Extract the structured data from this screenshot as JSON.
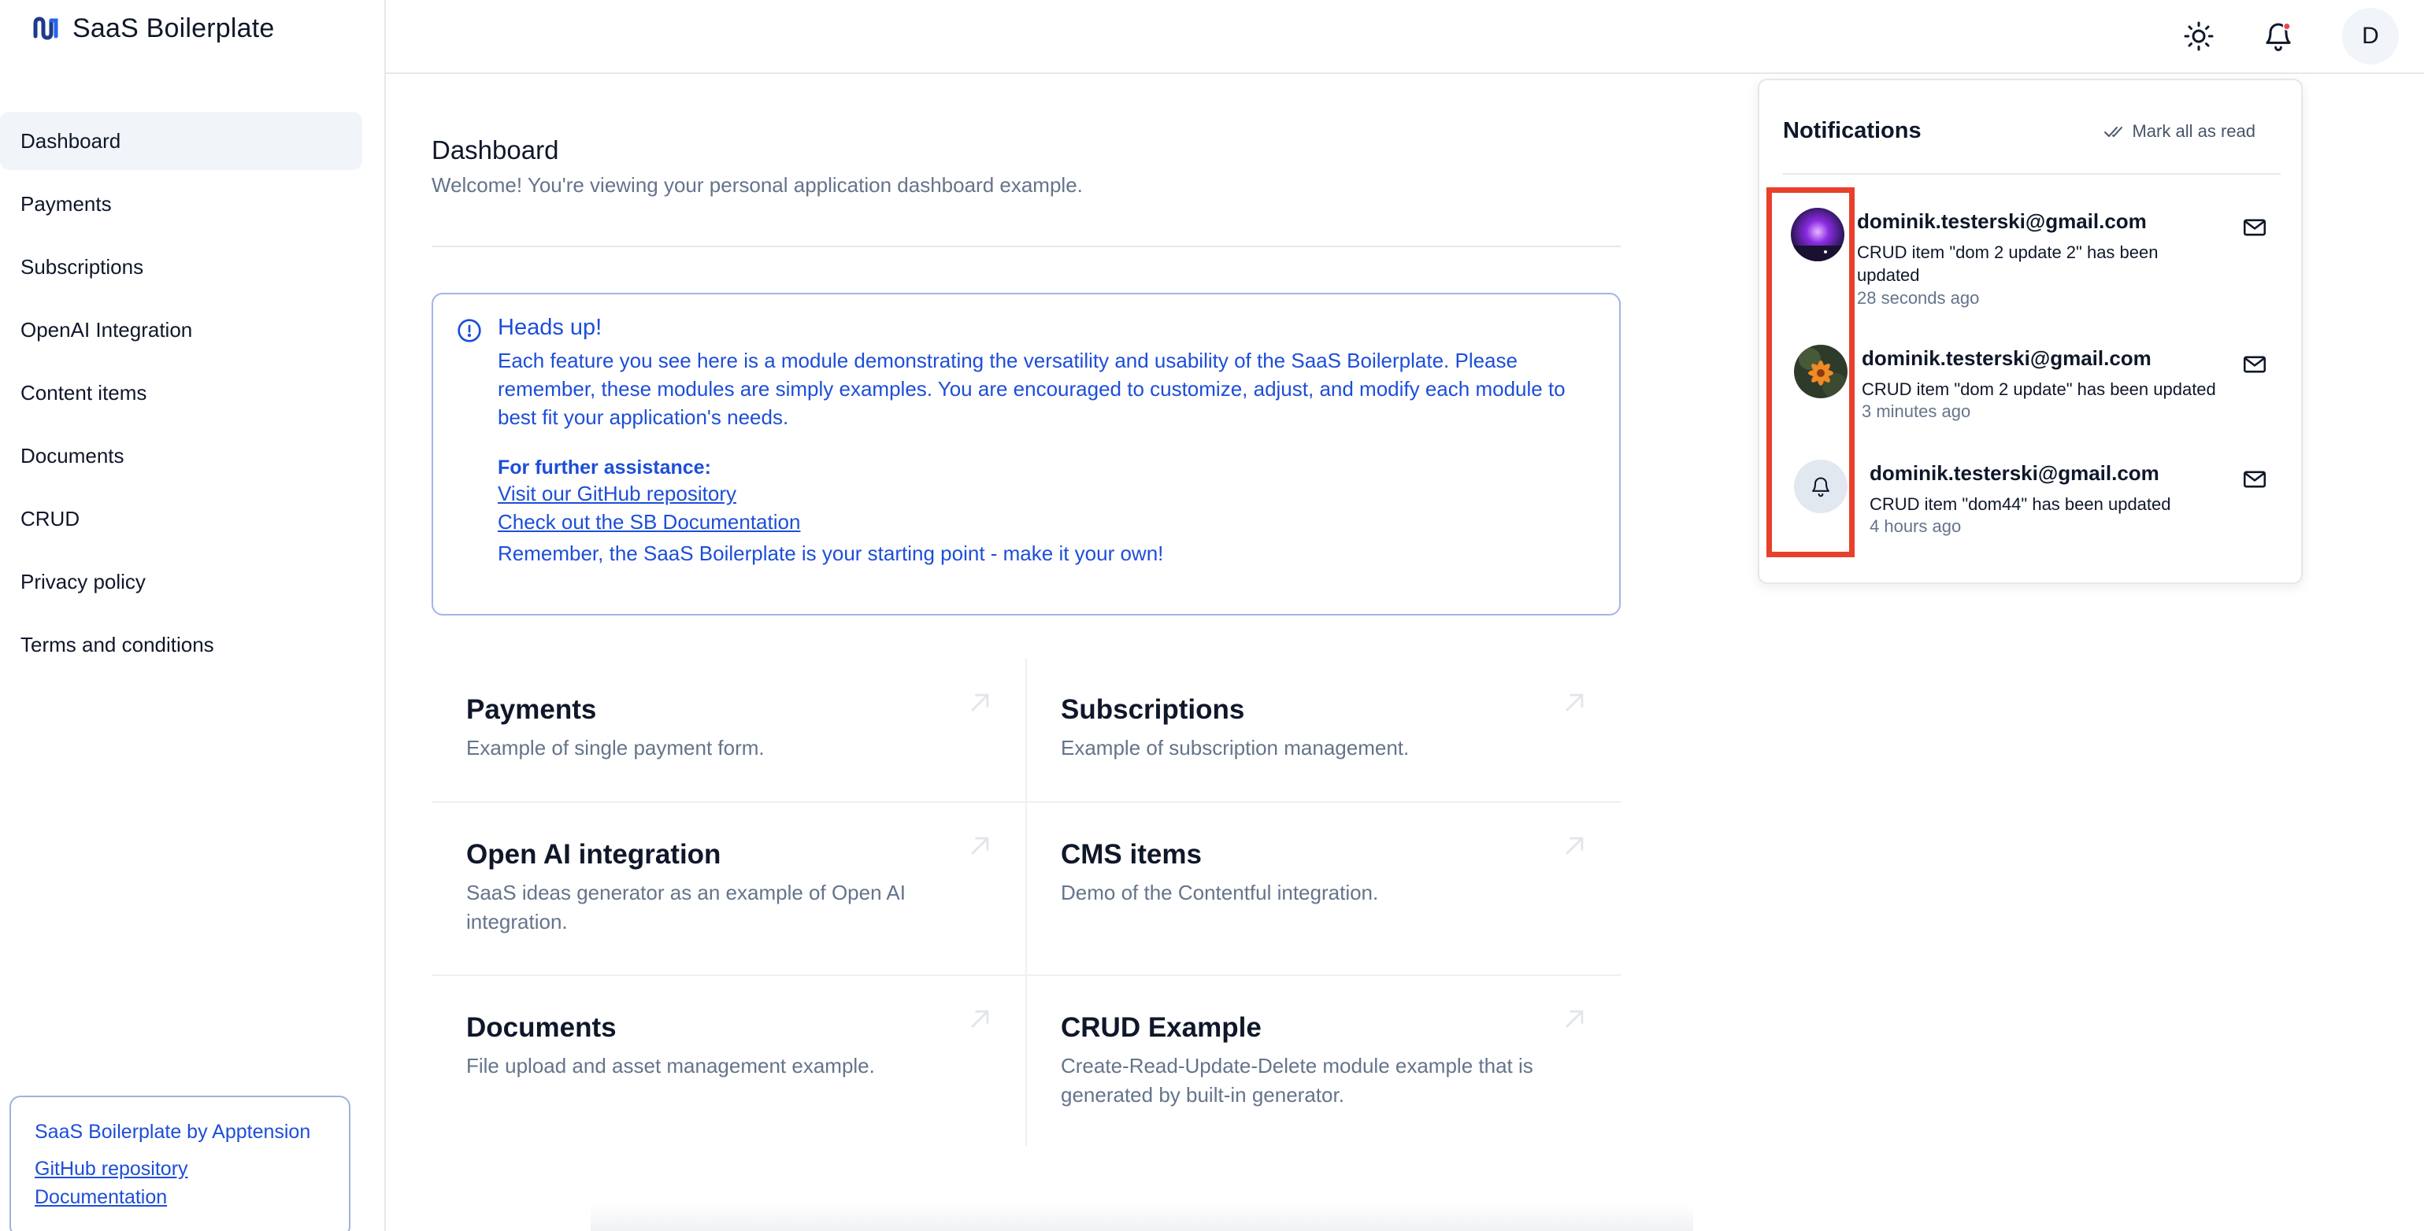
{
  "app": {
    "name": "SaaS Boilerplate"
  },
  "sidebar": {
    "items": [
      {
        "label": "Dashboard"
      },
      {
        "label": "Payments"
      },
      {
        "label": "Subscriptions"
      },
      {
        "label": "OpenAI Integration"
      },
      {
        "label": "Content items"
      },
      {
        "label": "Documents"
      },
      {
        "label": "CRUD"
      },
      {
        "label": "Privacy policy"
      },
      {
        "label": "Terms and conditions"
      }
    ],
    "active_item": "Dashboard",
    "footer": {
      "title": "SaaS Boilerplate by Apptension",
      "github_link": "GitHub repository",
      "docs_link": "Documentation"
    }
  },
  "header": {
    "avatar_initial": "D",
    "icons": [
      "sun-icon",
      "bell-icon"
    ],
    "unread_dot_color": "#ef4444"
  },
  "main": {
    "title": "Dashboard",
    "subtitle": "Welcome! You're viewing your personal application dashboard example.",
    "alert": {
      "title": "Heads up!",
      "body": "Each feature you see here is a module demonstrating the versatility and usability of the SaaS Boilerplate. Please remember, these modules are simply examples. You are encouraged to customize, adjust, and modify each module to best fit your application's needs.",
      "help_title": "For further assistance:",
      "link_github": "Visit our GitHub repository",
      "link_docs": "Check out the SB Documentation",
      "footer": "Remember, the SaaS Boilerplate is your starting point - make it your own!"
    },
    "cards": [
      {
        "title": "Payments",
        "description": "Example of single payment form."
      },
      {
        "title": "Subscriptions",
        "description": "Example of subscription management."
      },
      {
        "title": "Open AI integration",
        "description": "SaaS ideas generator as an example of Open AI integration."
      },
      {
        "title": "CMS items",
        "description": "Demo of the Contentful integration."
      },
      {
        "title": "Documents",
        "description": "File upload and asset management example."
      },
      {
        "title": "CRUD Example",
        "description": "Create-Read-Update-Delete module example that is generated by built-in generator."
      }
    ]
  },
  "notifications": {
    "title": "Notifications",
    "mark_all_label": "Mark all as read",
    "items": [
      {
        "email": "dominik.testerski@gmail.com",
        "message": "CRUD item \"dom 2 update 2\" has been updated",
        "time": "28 seconds ago",
        "avatar": "galaxy"
      },
      {
        "email": "dominik.testerski@gmail.com",
        "message": "CRUD item \"dom 2 update\" has been updated",
        "time": "3 minutes ago",
        "avatar": "flower"
      },
      {
        "email": "dominik.testerski@gmail.com",
        "message": "CRUD item \"dom44\" has been updated",
        "time": "4 hours ago",
        "avatar": "bell-icon"
      }
    ]
  },
  "colors": {
    "accent": "#1d4ed8",
    "highlight_box": "#e8402a",
    "muted_text": "#64748b"
  }
}
